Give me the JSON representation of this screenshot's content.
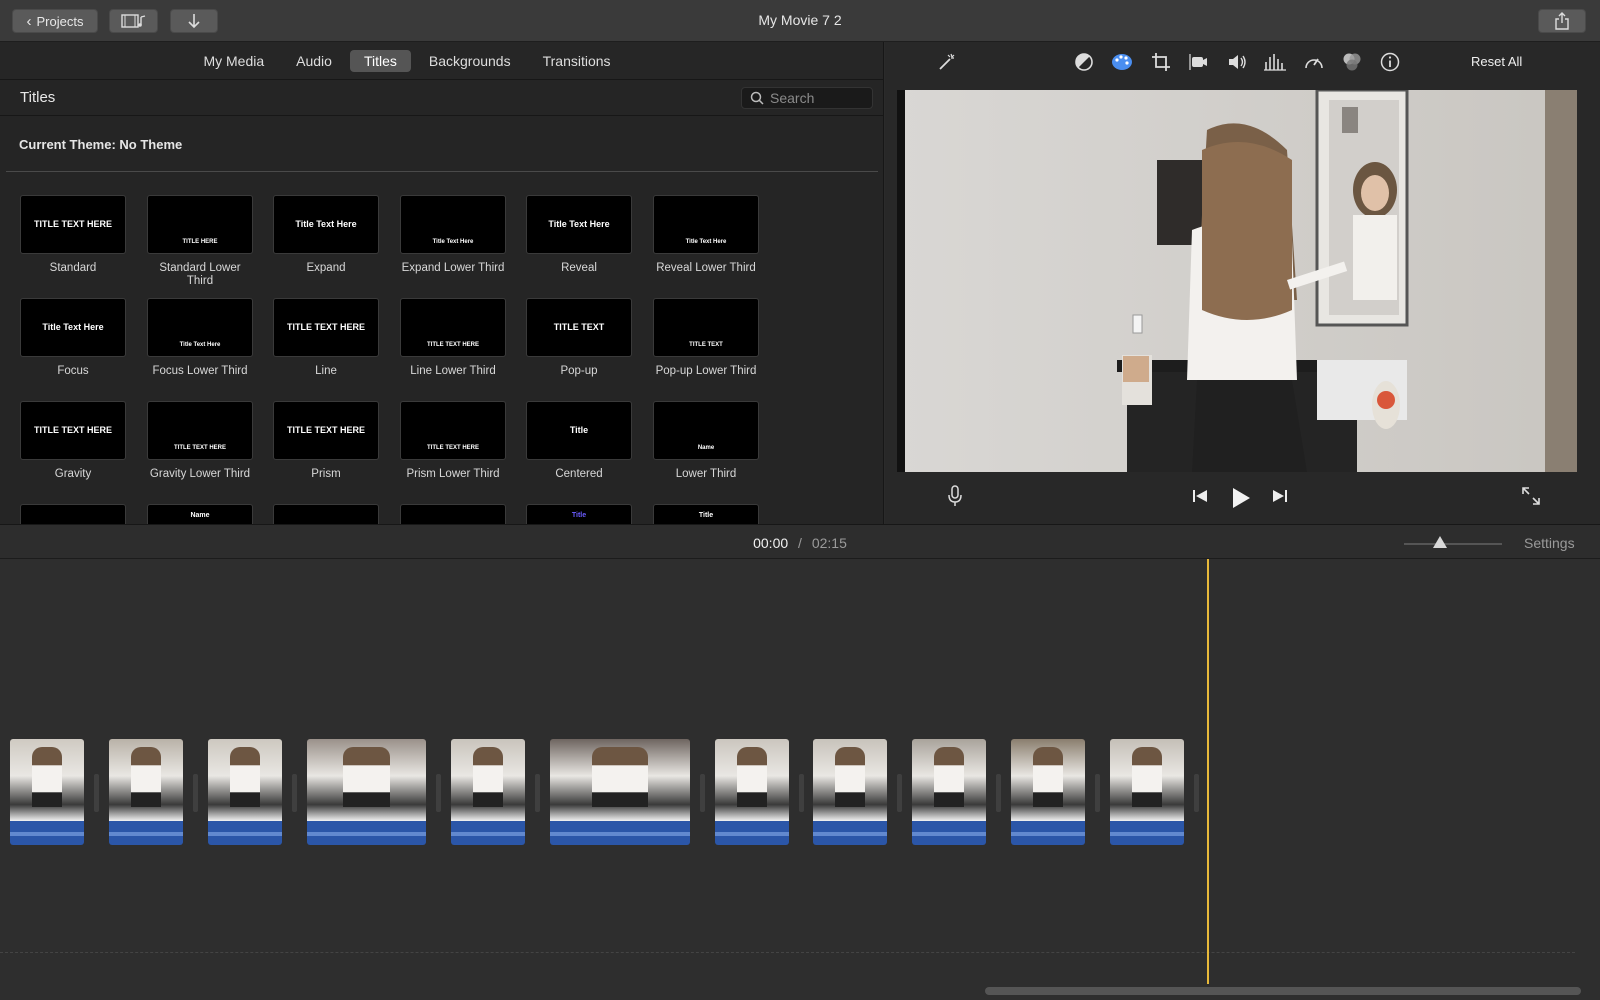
{
  "window": {
    "title": "My Movie 7 2"
  },
  "toolbar": {
    "projects_label": "Projects"
  },
  "browser": {
    "tabs": [
      {
        "label": "My Media"
      },
      {
        "label": "Audio"
      },
      {
        "label": "Titles"
      },
      {
        "label": "Backgrounds"
      },
      {
        "label": "Transitions"
      }
    ],
    "active_tab": "Titles",
    "panel_title": "Titles",
    "search_placeholder": "Search",
    "theme_label": "Current Theme: No Theme",
    "titles": [
      {
        "label": "Standard",
        "preview": "TITLE TEXT HERE"
      },
      {
        "label": "Standard Lower Third",
        "preview": "TITLE HERE"
      },
      {
        "label": "Expand",
        "preview": "Title Text Here"
      },
      {
        "label": "Expand Lower Third",
        "preview": "Title Text Here"
      },
      {
        "label": "Reveal",
        "preview": "Title Text Here"
      },
      {
        "label": "Reveal Lower Third",
        "preview": "Title Text Here"
      },
      {
        "label": "Focus",
        "preview": "Title Text Here"
      },
      {
        "label": "Focus Lower Third",
        "preview": "Title Text Here"
      },
      {
        "label": "Line",
        "preview": "TITLE TEXT HERE"
      },
      {
        "label": "Line Lower Third",
        "preview": "TITLE TEXT HERE"
      },
      {
        "label": "Pop-up",
        "preview": "TITLE TEXT"
      },
      {
        "label": "Pop-up Lower Third",
        "preview": "TITLE TEXT"
      },
      {
        "label": "Gravity",
        "preview": "TITLE TEXT HERE"
      },
      {
        "label": "Gravity Lower Third",
        "preview": "TITLE TEXT HERE"
      },
      {
        "label": "Prism",
        "preview": "TITLE TEXT HERE"
      },
      {
        "label": "Prism Lower Third",
        "preview": "TITLE TEXT HERE"
      },
      {
        "label": "Centered",
        "preview": "Title"
      },
      {
        "label": "Lower Third",
        "preview": "Name"
      }
    ],
    "partial_row": [
      "",
      "Name",
      "",
      "",
      "Title",
      "Title"
    ]
  },
  "viewer": {
    "reset_label": "Reset All",
    "tools": [
      "magic-wand-icon",
      "color-balance-icon",
      "color-correction-icon",
      "crop-icon",
      "stabilization-icon",
      "volume-icon",
      "equalizer-icon",
      "speed-icon",
      "clip-filter-icon",
      "info-icon"
    ]
  },
  "timeline": {
    "current_time": "00:00",
    "separator": "/",
    "total_time": "02:15",
    "settings_label": "Settings",
    "clips": [
      {
        "tone": "#cfcac2"
      },
      {
        "tone": "#b9b2a8"
      },
      {
        "tone": "#cdc8c0"
      },
      {
        "tone": "#9a918a"
      },
      {
        "tone": "#c9c4bc"
      },
      {
        "tone": "#6e6560"
      },
      {
        "tone": "#cbc6be"
      },
      {
        "tone": "#c8c3bb"
      },
      {
        "tone": "#a9a39b"
      },
      {
        "tone": "#8a7e6e"
      },
      {
        "tone": "#c4bfb7"
      }
    ]
  },
  "colors": {
    "accent_blue": "#4a8ef0",
    "audio_blue": "#2b56a8",
    "playhead": "#e8b93a"
  }
}
